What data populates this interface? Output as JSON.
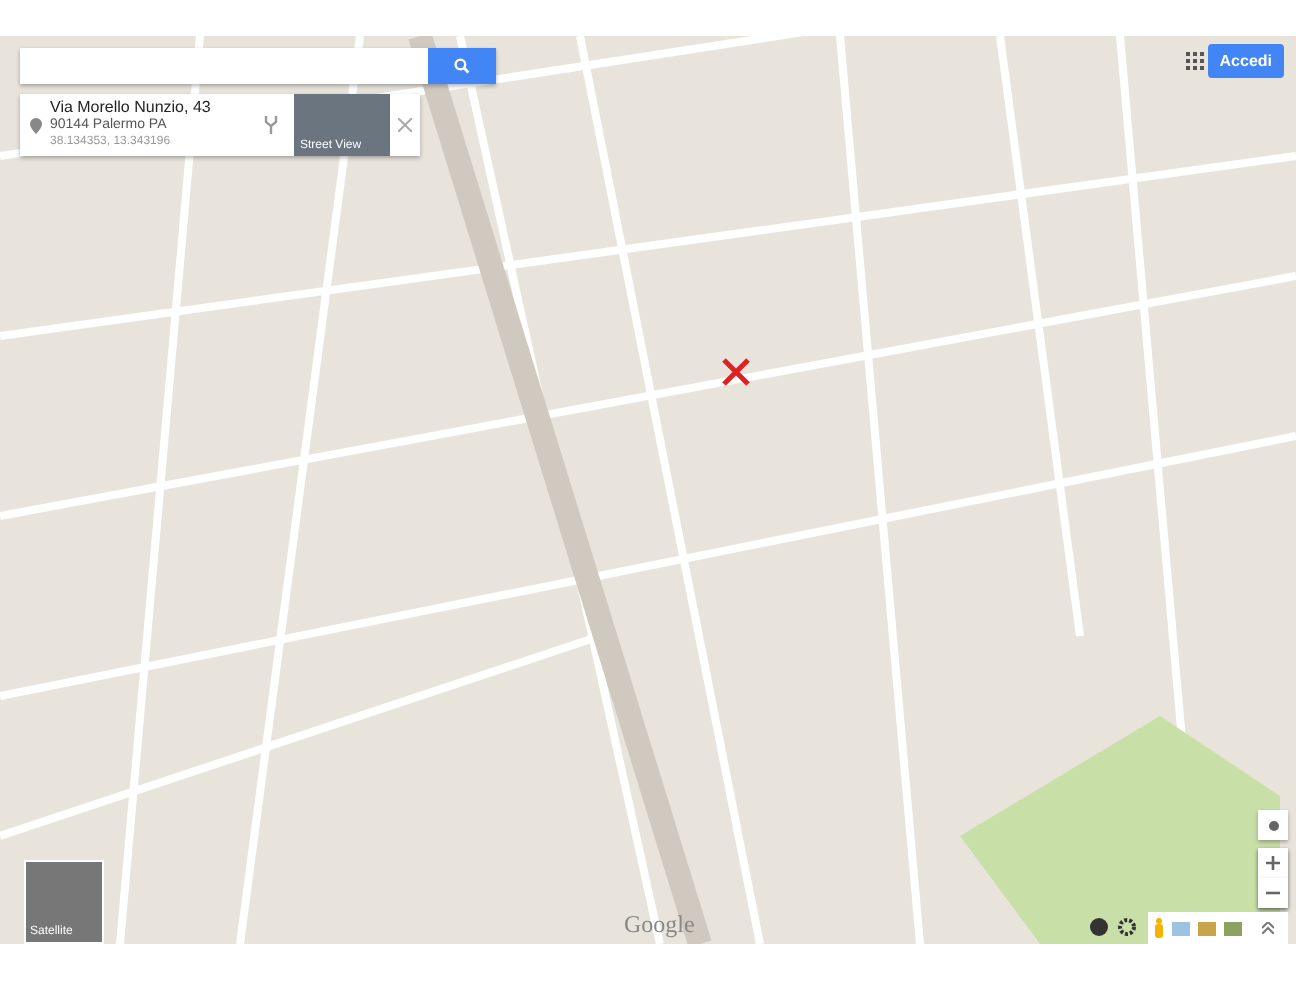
{
  "header": {
    "signin_button": "Accedi"
  },
  "place_card": {
    "title": "Via Morello Nunzio, 43",
    "address": "90144 Palermo PA",
    "coordinates": "38.134353, 13.343196",
    "street_view_label": "Street View"
  },
  "map": {
    "satellite_label": "Satellite",
    "logo": "Google"
  }
}
